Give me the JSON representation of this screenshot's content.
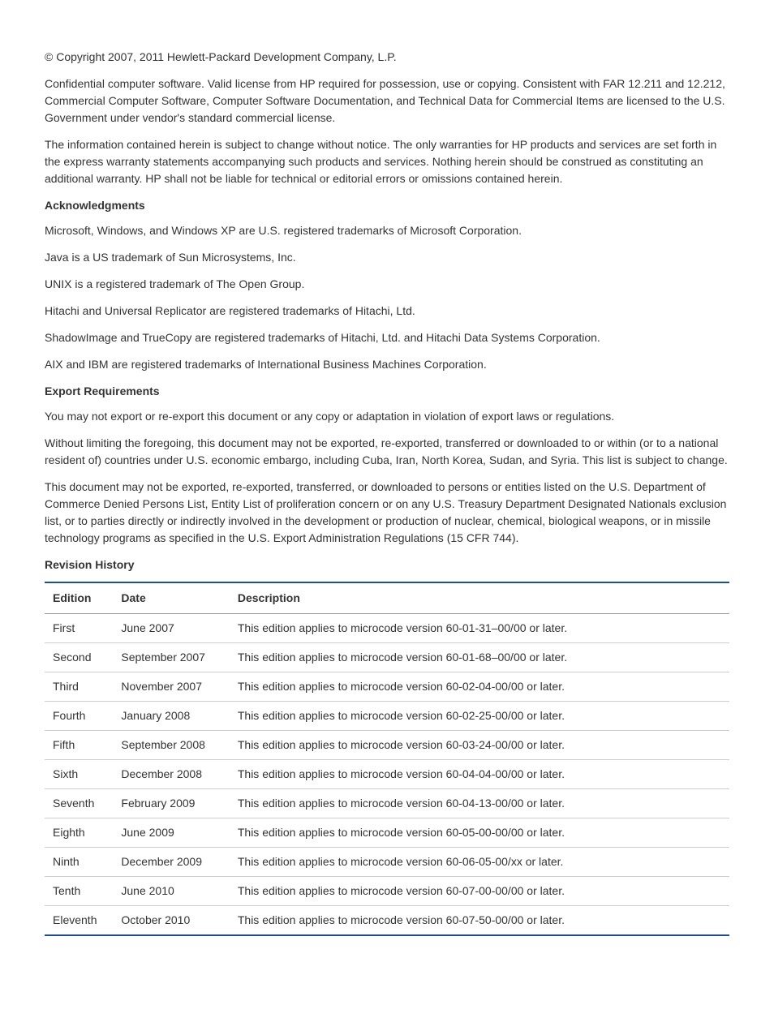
{
  "copyright": "© Copyright 2007, 2011 Hewlett-Packard Development Company, L.P.",
  "confidential": "Confidential computer software. Valid license from HP required for possession, use or copying. Consistent with FAR 12.211 and 12.212, Commercial Computer Software, Computer Software Documentation, and Technical Data for Commercial Items are licensed to the U.S. Government under vendor's standard commercial license.",
  "info_notice": "The information contained herein is subject to change without notice. The only warranties for HP products and services are set forth in the express warranty statements accompanying such products and services. Nothing herein should be construed as constituting an additional warranty. HP shall not be liable for technical or editorial errors or omissions contained herein.",
  "ack_heading": "Acknowledgments",
  "ack": {
    "microsoft": "Microsoft, Windows, and Windows XP are U.S. registered trademarks of Microsoft Corporation.",
    "java": "Java is a US trademark of Sun Microsystems, Inc.",
    "unix": "UNIX is a registered trademark of The Open Group.",
    "hitachi": "Hitachi and Universal Replicator are registered trademarks of Hitachi, Ltd.",
    "shadowimage": "ShadowImage and TrueCopy are registered trademarks of Hitachi, Ltd. and Hitachi Data Systems Corporation.",
    "aix": "AIX and IBM are registered trademarks of International Business Machines Corporation."
  },
  "export_heading": "Export Requirements",
  "export": {
    "p1": "You may not export or re-export this document or any copy or adaptation in violation of export laws or regulations.",
    "p2": "Without limiting the foregoing, this document may not be exported, re-exported, transferred or downloaded to or within (or to a national resident of) countries under U.S. economic embargo, including Cuba, Iran, North Korea, Sudan, and Syria. This list is subject to change.",
    "p3": "This document may not be exported, re-exported, transferred, or downloaded to persons or entities listed on the U.S. Department of Commerce Denied Persons List, Entity List of proliferation concern or on any U.S. Treasury Department Designated Nationals exclusion list, or to parties directly or indirectly involved in the development or production of nuclear, chemical, biological weapons, or in missile technology programs as specified in the U.S. Export Administration Regulations (15 CFR 744)."
  },
  "revision_heading": "Revision History",
  "table": {
    "headers": {
      "edition": "Edition",
      "date": "Date",
      "description": "Description"
    },
    "rows": [
      {
        "edition": "First",
        "date": "June 2007",
        "description": "This edition applies to microcode version 60-01-31–00/00 or later."
      },
      {
        "edition": "Second",
        "date": "September 2007",
        "description": "This edition applies to microcode version 60-01-68–00/00 or later."
      },
      {
        "edition": "Third",
        "date": "November 2007",
        "description": "This edition applies to microcode version 60-02-04-00/00 or later."
      },
      {
        "edition": "Fourth",
        "date": "January 2008",
        "description": "This edition applies to microcode version 60-02-25-00/00 or later."
      },
      {
        "edition": "Fifth",
        "date": "September 2008",
        "description": "This edition applies to microcode version 60-03-24-00/00 or later."
      },
      {
        "edition": "Sixth",
        "date": "December 2008",
        "description": "This edition applies to microcode version 60-04-04-00/00 or later."
      },
      {
        "edition": "Seventh",
        "date": "February 2009",
        "description": "This edition applies to microcode version 60-04-13-00/00 or later."
      },
      {
        "edition": "Eighth",
        "date": "June 2009",
        "description": "This edition applies to microcode version 60-05-00-00/00 or later."
      },
      {
        "edition": "Ninth",
        "date": "December 2009",
        "description": "This edition applies to microcode version 60-06-05-00/xx or later."
      },
      {
        "edition": "Tenth",
        "date": "June 2010",
        "description": "This edition applies to microcode version 60-07-00-00/00 or later."
      },
      {
        "edition": "Eleventh",
        "date": "October 2010",
        "description": "This edition applies to microcode version 60-07-50-00/00 or later."
      }
    ]
  }
}
